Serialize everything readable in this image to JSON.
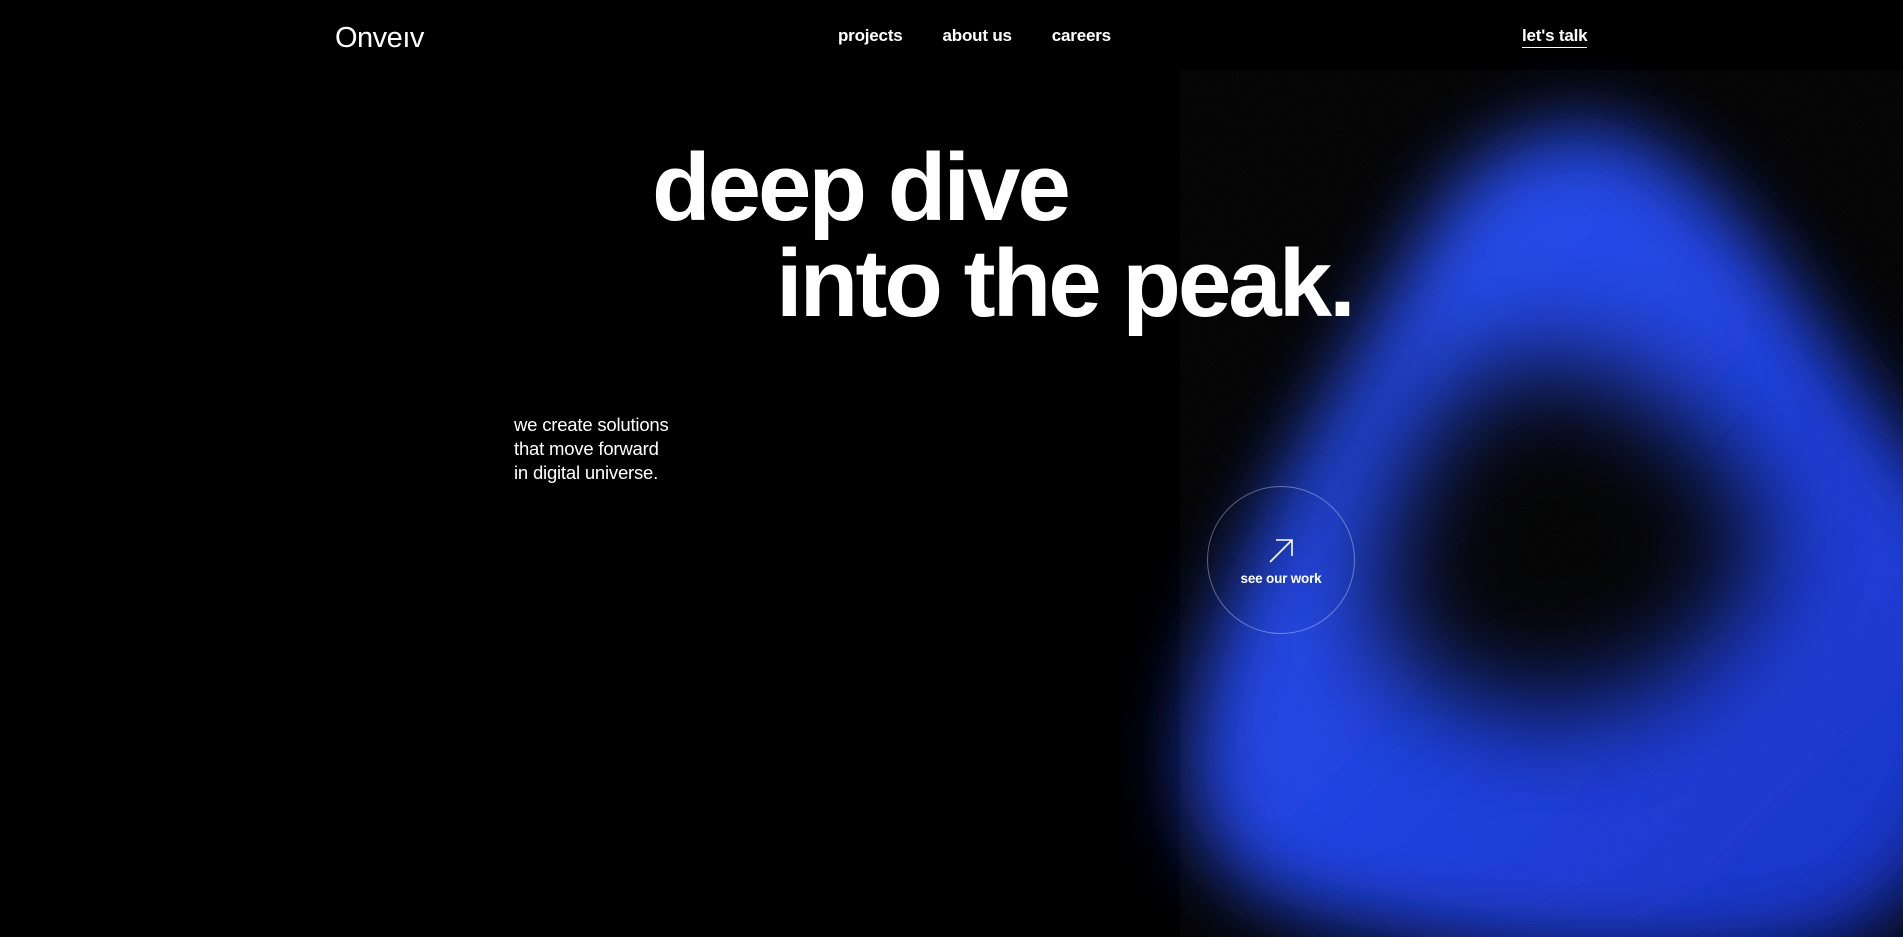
{
  "brand": {
    "logo_text": "Onveıv"
  },
  "nav": {
    "items": [
      {
        "label": "projects"
      },
      {
        "label": "about us"
      },
      {
        "label": "careers"
      }
    ],
    "cta_label": "let's talk"
  },
  "hero": {
    "headline_line1": "deep dive",
    "headline_line2": "into the peak.",
    "subtext": [
      "we create solutions",
      "that move forward",
      "in digital universe."
    ],
    "circle_cta_label": "see our work",
    "circle_cta_icon": "arrow-up-right-icon"
  },
  "colors": {
    "background": "#000000",
    "text": "#ffffff",
    "accent_blue": "#1f47ff"
  }
}
